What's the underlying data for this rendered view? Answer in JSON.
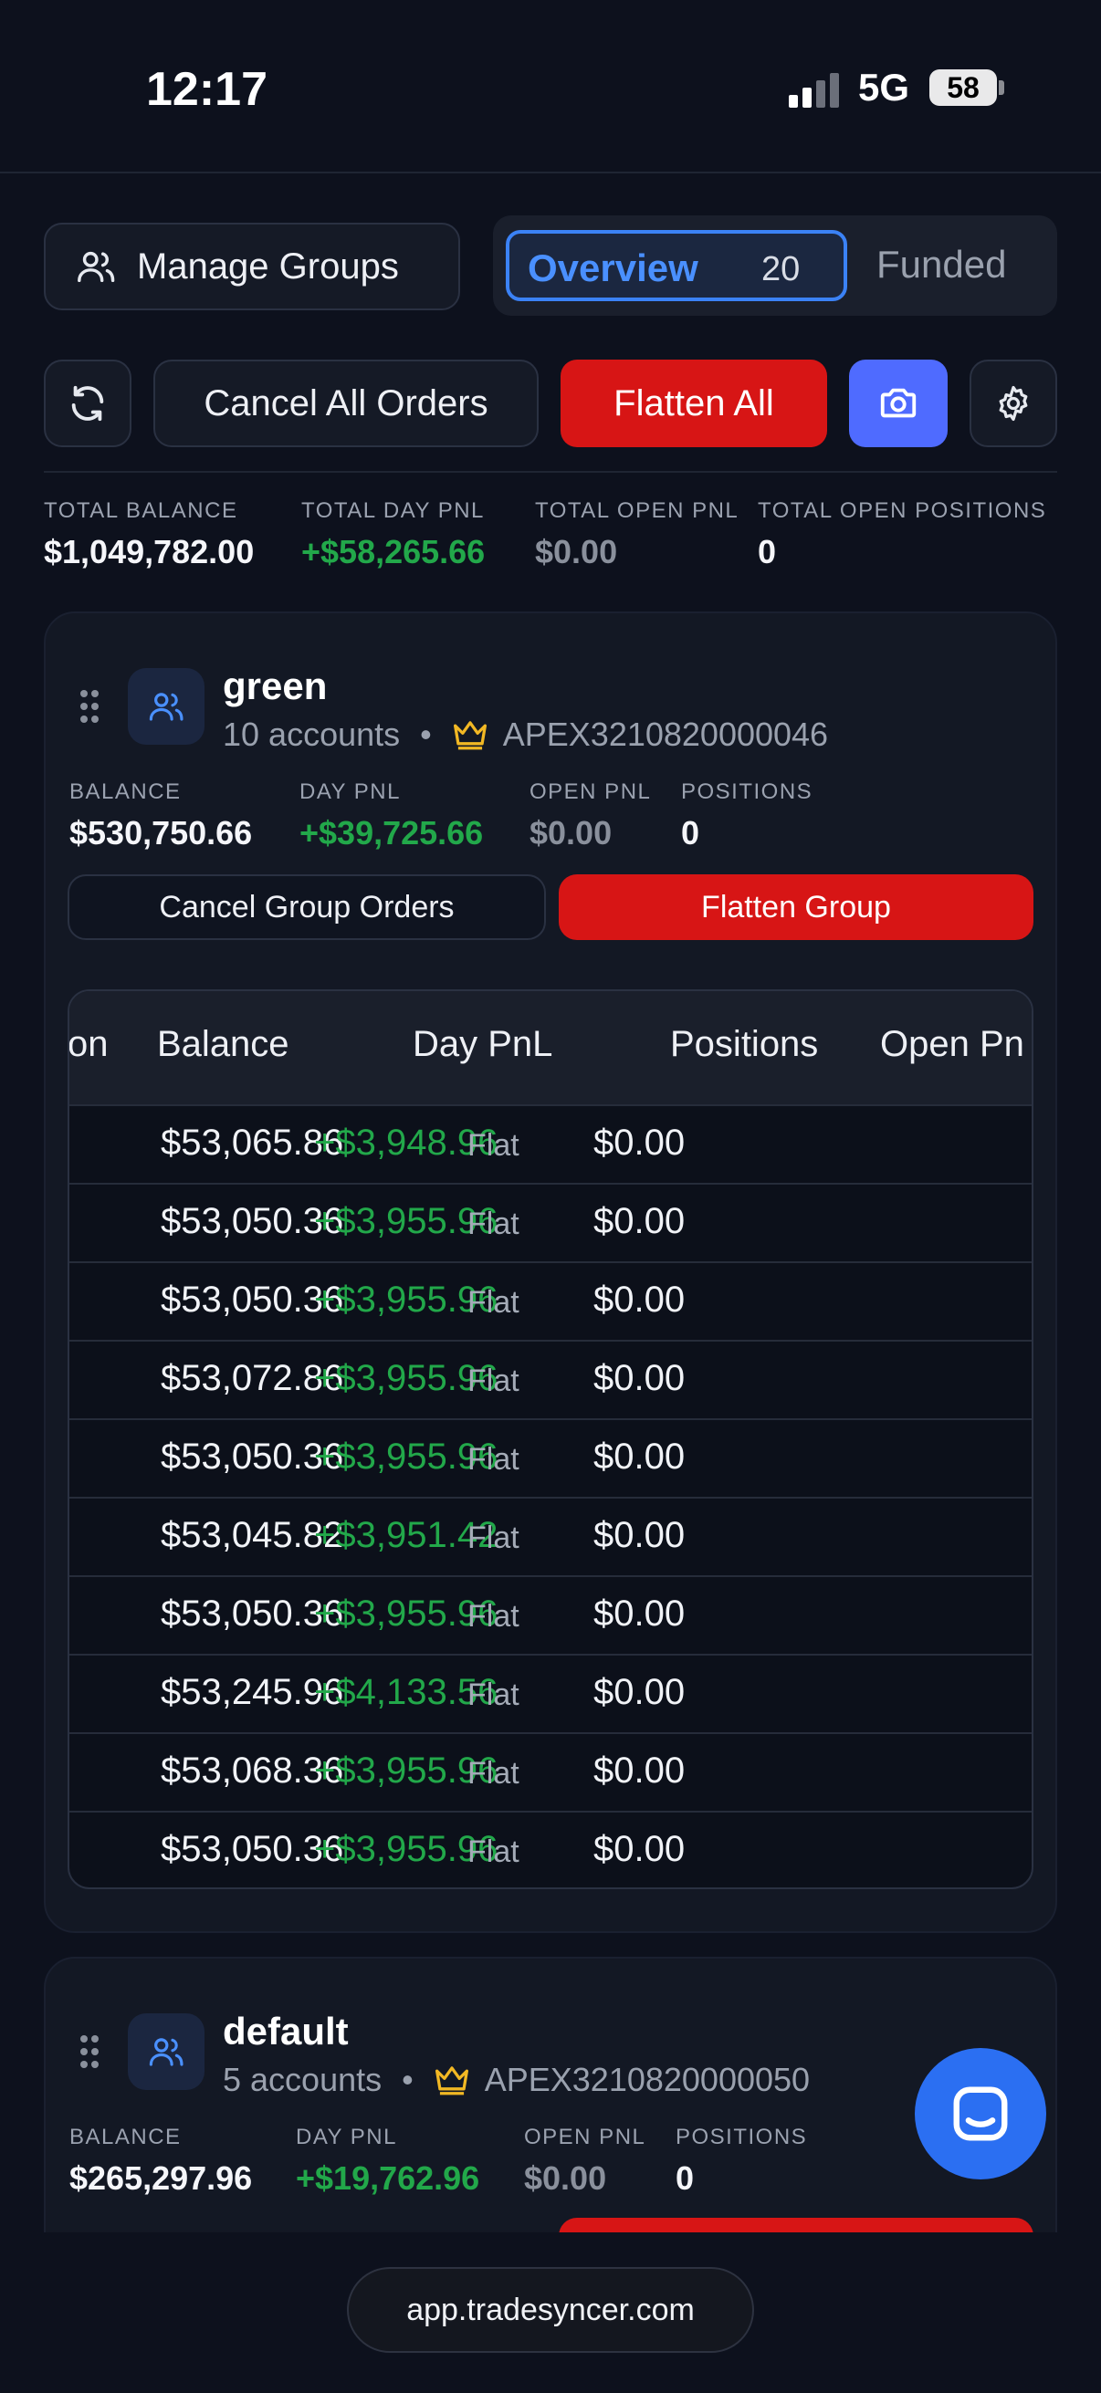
{
  "status": {
    "time": "12:17",
    "network": "5G",
    "battery": "58"
  },
  "toolbar": {
    "manage_groups": "Manage Groups",
    "tabs": [
      {
        "label": "Overview",
        "count": "20"
      },
      {
        "label": "Funded"
      }
    ],
    "cancel_all": "Cancel All Orders",
    "flatten_all": "Flatten All"
  },
  "totals": {
    "balance_label": "TOTAL BALANCE",
    "balance": "$1,049,782.00",
    "day_pnl_label": "TOTAL DAY PNL",
    "day_pnl": "+$58,265.66",
    "open_pnl_label": "TOTAL OPEN PNL",
    "open_pnl": "$0.00",
    "positions_label": "TOTAL OPEN POSITIONS",
    "positions": "0"
  },
  "groups": [
    {
      "name": "green",
      "accounts": "10 accounts",
      "leader": "APEX3210820000046",
      "balance_label": "BALANCE",
      "balance": "$530,750.66",
      "day_pnl_label": "DAY PNL",
      "day_pnl": "+$39,725.66",
      "open_pnl_label": "OPEN PNL",
      "open_pnl": "$0.00",
      "positions_label": "POSITIONS",
      "positions": "0",
      "cancel_label": "Cancel Group Orders",
      "flatten_label": "Flatten Group",
      "table": {
        "headers": [
          "on",
          "Balance",
          "Day PnL",
          "Positions",
          "Open Pn"
        ],
        "rows": [
          [
            "$53,065.86",
            "+$3,948.96",
            "Flat",
            "$0.00"
          ],
          [
            "$53,050.36",
            "+$3,955.96",
            "Flat",
            "$0.00"
          ],
          [
            "$53,050.36",
            "+$3,955.96",
            "Flat",
            "$0.00"
          ],
          [
            "$53,072.86",
            "+$3,955.96",
            "Flat",
            "$0.00"
          ],
          [
            "$53,050.36",
            "+$3,955.96",
            "Flat",
            "$0.00"
          ],
          [
            "$53,045.82",
            "+$3,951.42",
            "Flat",
            "$0.00"
          ],
          [
            "$53,050.36",
            "+$3,955.96",
            "Flat",
            "$0.00"
          ],
          [
            "$53,245.96",
            "+$4,133.56",
            "Flat",
            "$0.00"
          ],
          [
            "$53,068.36",
            "+$3,955.96",
            "Flat",
            "$0.00"
          ],
          [
            "$53,050.36",
            "+$3,955.96",
            "Flat",
            "$0.00"
          ]
        ]
      }
    },
    {
      "name": "default",
      "accounts": "5 accounts",
      "leader": "APEX3210820000050",
      "balance_label": "BALANCE",
      "balance": "$265,297.96",
      "day_pnl_label": "DAY PNL",
      "day_pnl": "+$19,762.96",
      "open_pnl_label": "OPEN PNL",
      "open_pnl": "$0.00",
      "positions_label": "POSITIONS",
      "positions": "0"
    }
  ],
  "browser": {
    "url": "app.tradesyncer.com"
  },
  "colors": {
    "accent": "#3b82f6",
    "danger": "#d71515",
    "positive": "#22a84a",
    "camera": "#4f6bff",
    "chat": "#2b6ff2"
  }
}
